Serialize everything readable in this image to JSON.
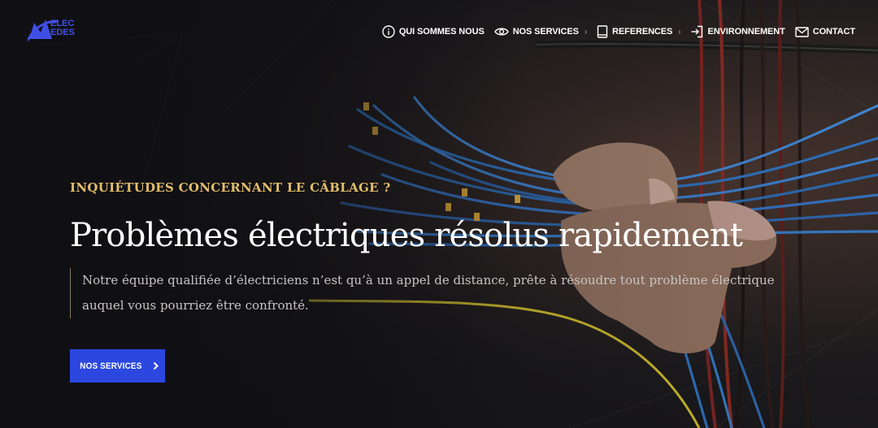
{
  "header": {
    "logo": {
      "line1": "ELEC",
      "line2": "EDES"
    },
    "nav": [
      {
        "label": "QUI SOMMES NOUS",
        "icon": "info-icon"
      },
      {
        "label": "NOS SERVICES",
        "icon": "eye-icon",
        "has_dropdown": true
      },
      {
        "label": "REFERENCES",
        "icon": "book-icon",
        "has_dropdown": true
      },
      {
        "label": "ENVIRONNEMENT",
        "icon": "login-icon"
      },
      {
        "label": "CONTACT",
        "icon": "mail-icon"
      }
    ]
  },
  "hero": {
    "kicker": "INQUIÉTUDES CONCERNANT LE CÂBLAGE ?",
    "headline": "Problèmes électriques résolus rapidement",
    "description": "Notre équipe qualifiée d’électriciens n’est qu’à un appel de distance, prête à résoudre tout problème électrique auquel vous pourriez être confronté.",
    "cta_label": "NOS SERVICES",
    "cta_icon": "chevron-right-icon"
  },
  "colors": {
    "brand_blue": "#2b47e0",
    "kicker_gold": "#e2bd6a",
    "text_white": "#ffffff"
  }
}
